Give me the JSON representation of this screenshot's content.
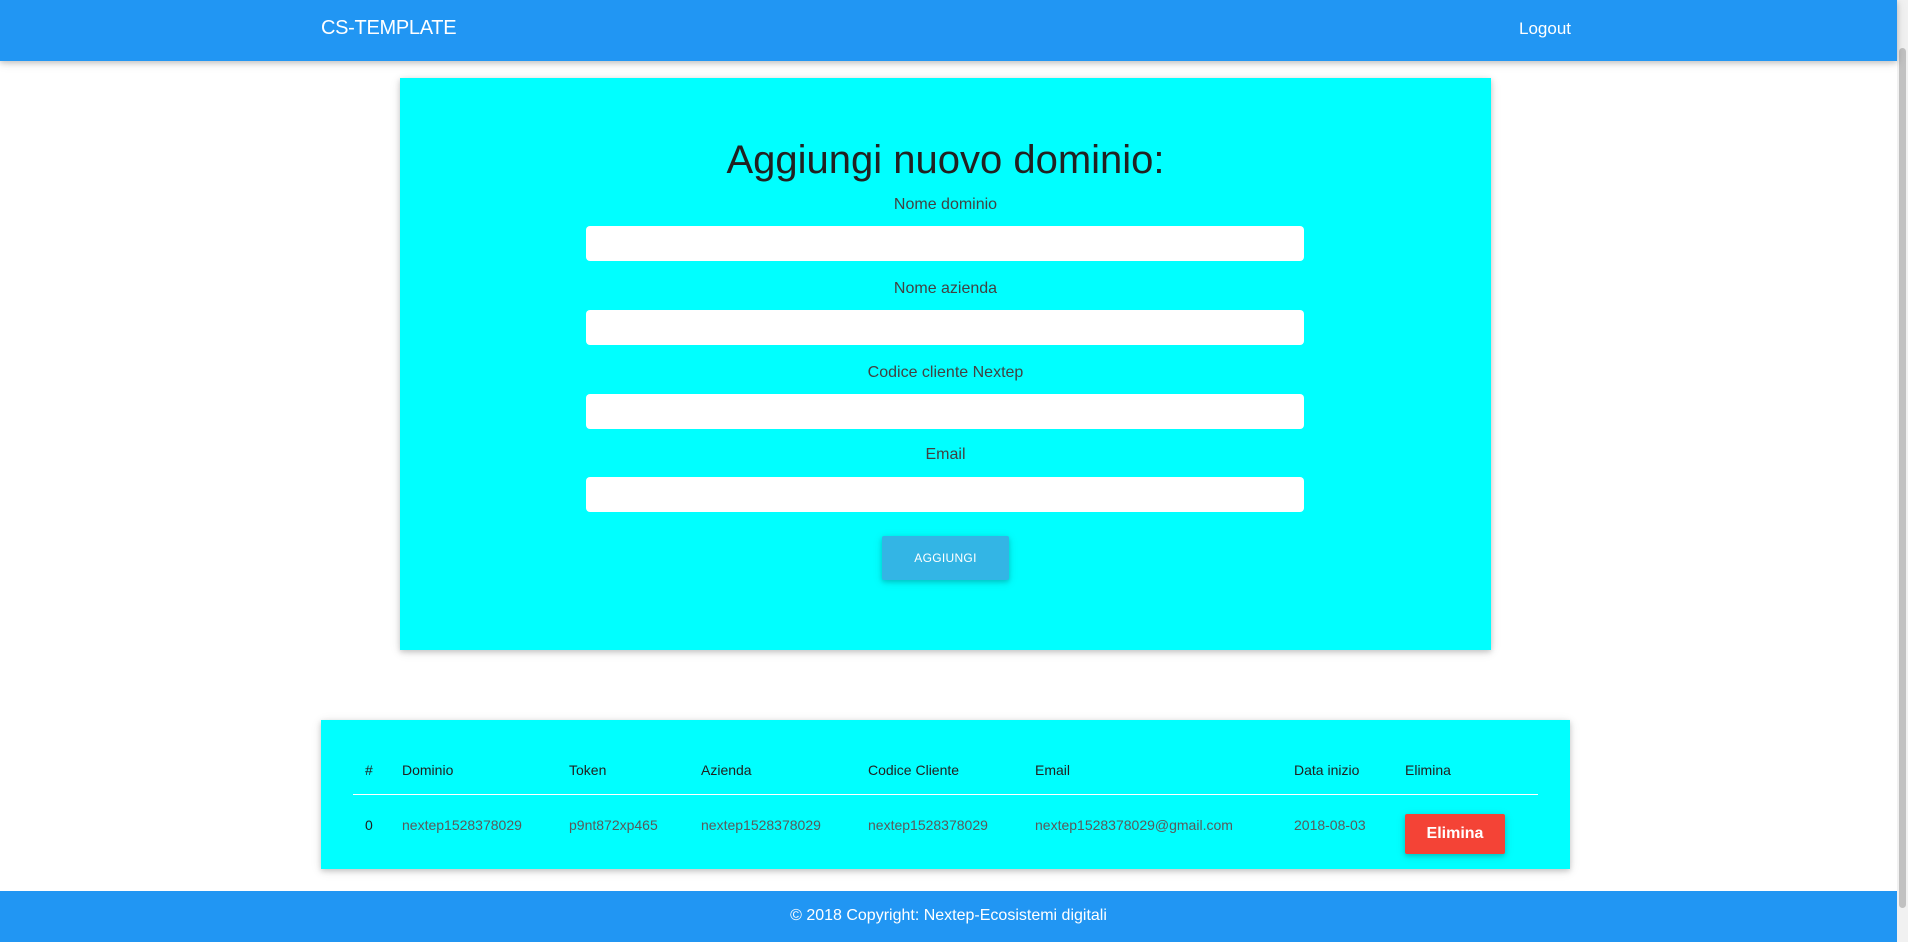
{
  "navbar": {
    "brand": "CS-TEMPLATE",
    "logout": "Logout"
  },
  "form": {
    "title": "Aggiungi nuovo dominio:",
    "fields": [
      {
        "label": "Nome dominio",
        "value": ""
      },
      {
        "label": "Nome azienda",
        "value": ""
      },
      {
        "label": "Codice cliente Nextep",
        "value": ""
      },
      {
        "label": "Email",
        "value": ""
      }
    ],
    "submit_label": "AGGIUNGI"
  },
  "table": {
    "headers": [
      "#",
      "Dominio",
      "Token",
      "Azienda",
      "Codice Cliente",
      "Email",
      "Data inizio",
      "Elimina"
    ],
    "rows": [
      {
        "index": "0",
        "dominio": "nextep1528378029",
        "token": "p9nt872xp465",
        "azienda": "nextep1528378029",
        "codice_cliente": "nextep1528378029",
        "email": "nextep1528378029@gmail.com",
        "data_inizio": "2018-08-03",
        "delete_label": "Elimina"
      }
    ]
  },
  "footer": {
    "text": "© 2018 Copyright: Nextep-Ecosistemi digitali"
  },
  "colors": {
    "primary": "#2196f3",
    "card": "#00ffff",
    "button": "#33b5e5",
    "danger": "#f44336"
  }
}
